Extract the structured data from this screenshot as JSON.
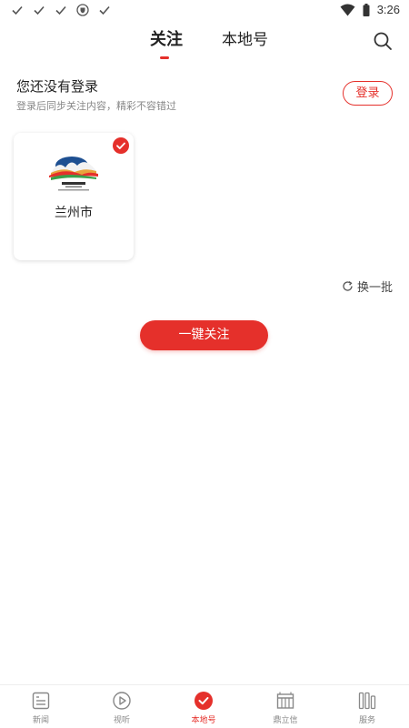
{
  "status_bar": {
    "time": "3:26",
    "left_icons": [
      "check-icon",
      "check-icon",
      "check-icon",
      "shield-icon",
      "check-icon"
    ],
    "right_icons": [
      "wifi-icon",
      "battery-icon"
    ]
  },
  "top_tabs": [
    {
      "label": "关注",
      "active": true
    },
    {
      "label": "本地号",
      "active": false
    }
  ],
  "login_prompt": {
    "title": "您还没有登录",
    "subtitle": "登录后同步关注内容，精彩不容错过",
    "button_label": "登录"
  },
  "cards": [
    {
      "name": "兰州市",
      "selected": true,
      "logo": "lanzhou-city-logo"
    }
  ],
  "refresh_label": "换一批",
  "follow_all_label": "一键关注",
  "bottom_nav": [
    {
      "label": "新闻",
      "icon": "news-icon",
      "active": false
    },
    {
      "label": "视听",
      "icon": "play-icon",
      "active": false
    },
    {
      "label": "本地号",
      "icon": "check-circle-icon",
      "active": true
    },
    {
      "label": "鼎立信",
      "icon": "building-icon",
      "active": false
    },
    {
      "label": "服务",
      "icon": "services-icon",
      "active": false
    }
  ],
  "colors": {
    "accent": "#e5302b",
    "text_primary": "#222222",
    "text_secondary": "#888888"
  }
}
